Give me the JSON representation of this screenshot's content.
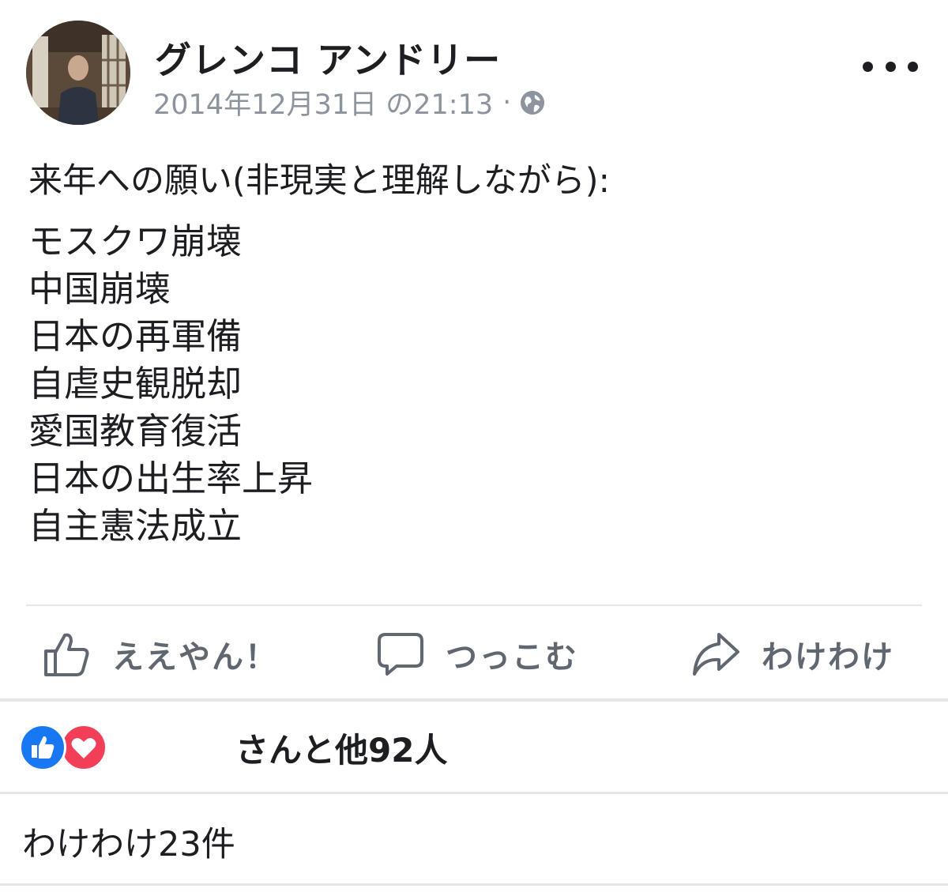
{
  "post": {
    "author": "グレンコ アンドリー",
    "timestamp": "2014年12月31日 の21:13",
    "separator": "·",
    "privacy_icon": "globe-icon",
    "menu_icon": "more-horizontal-icon",
    "intro": "来年への願い(非現実と理解しながら):",
    "wishes": [
      "モスクワ崩壊",
      "中国崩壊",
      "日本の再軍備",
      "自虐史観脱却",
      "愛国教育復活",
      "日本の出生率上昇",
      "自主憲法成立"
    ]
  },
  "actions": {
    "like_label": "ええやん！",
    "comment_label": "つっこむ",
    "share_label": "わけわけ"
  },
  "reactions": {
    "count_text": "さんと他92人",
    "like_color": "#1877f2",
    "love_color": "#f33e58"
  },
  "shares": {
    "text": "わけわけ23件"
  }
}
